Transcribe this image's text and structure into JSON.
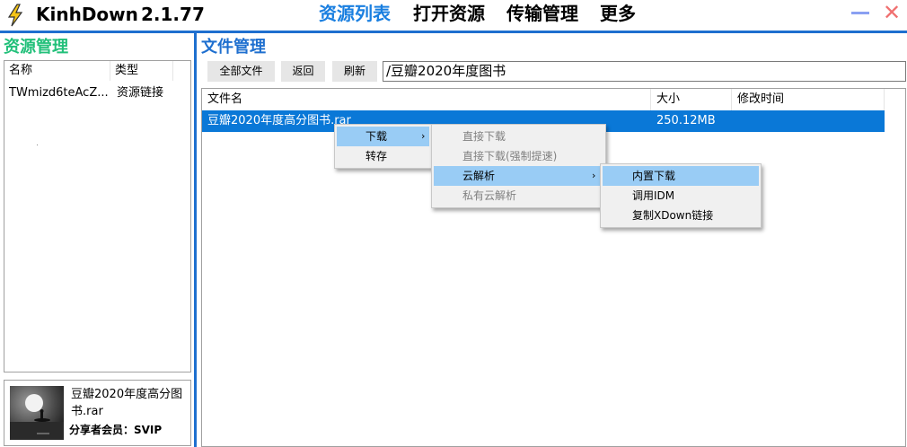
{
  "app": {
    "name": "KinhDown",
    "version": "2.1.77"
  },
  "nav": {
    "tabs": [
      {
        "label": "资源列表",
        "active": true
      },
      {
        "label": "打开资源",
        "active": false
      },
      {
        "label": "传输管理",
        "active": false
      },
      {
        "label": "更多",
        "active": false
      }
    ]
  },
  "window": {
    "minimize_icon": "minimize-icon",
    "close_glyph": "✕"
  },
  "left": {
    "title": "资源管理",
    "columns": [
      "名称",
      "类型"
    ],
    "rows": [
      {
        "name": "TWmizd6teAcZ...",
        "type": "资源链接"
      }
    ],
    "share": {
      "file_name": "豆瓣2020年度高分图书.rar",
      "member": "分享者会员：SVIP"
    }
  },
  "right": {
    "title": "文件管理",
    "buttons": {
      "all_files": "全部文件",
      "back": "返回",
      "refresh": "刷新"
    },
    "path": "/豆瓣2020年度图书",
    "columns": [
      "文件名",
      "大小",
      "修改时间"
    ],
    "files": [
      {
        "name": "豆瓣2020年度高分图书.rar",
        "size": "250.12MB",
        "modified": ""
      }
    ]
  },
  "context_menu": {
    "level1": [
      {
        "label": "下载",
        "arrow": "›"
      },
      {
        "label": "转存"
      }
    ],
    "level2": [
      {
        "label": "直接下载"
      },
      {
        "label": "直接下载(强制提速)"
      },
      {
        "label": "云解析",
        "arrow": "›"
      },
      {
        "label": "私有云解析"
      }
    ],
    "level3": [
      {
        "label": "内置下载"
      },
      {
        "label": "调用IDM"
      },
      {
        "label": "复制XDown链接"
      }
    ]
  },
  "colors": {
    "accent_blue": "#1e6fcf",
    "active_tab": "#1a7fe0",
    "left_title_green": "#22c07a",
    "selection": "#0a78d7",
    "menu_highlight": "#99ccf5"
  }
}
